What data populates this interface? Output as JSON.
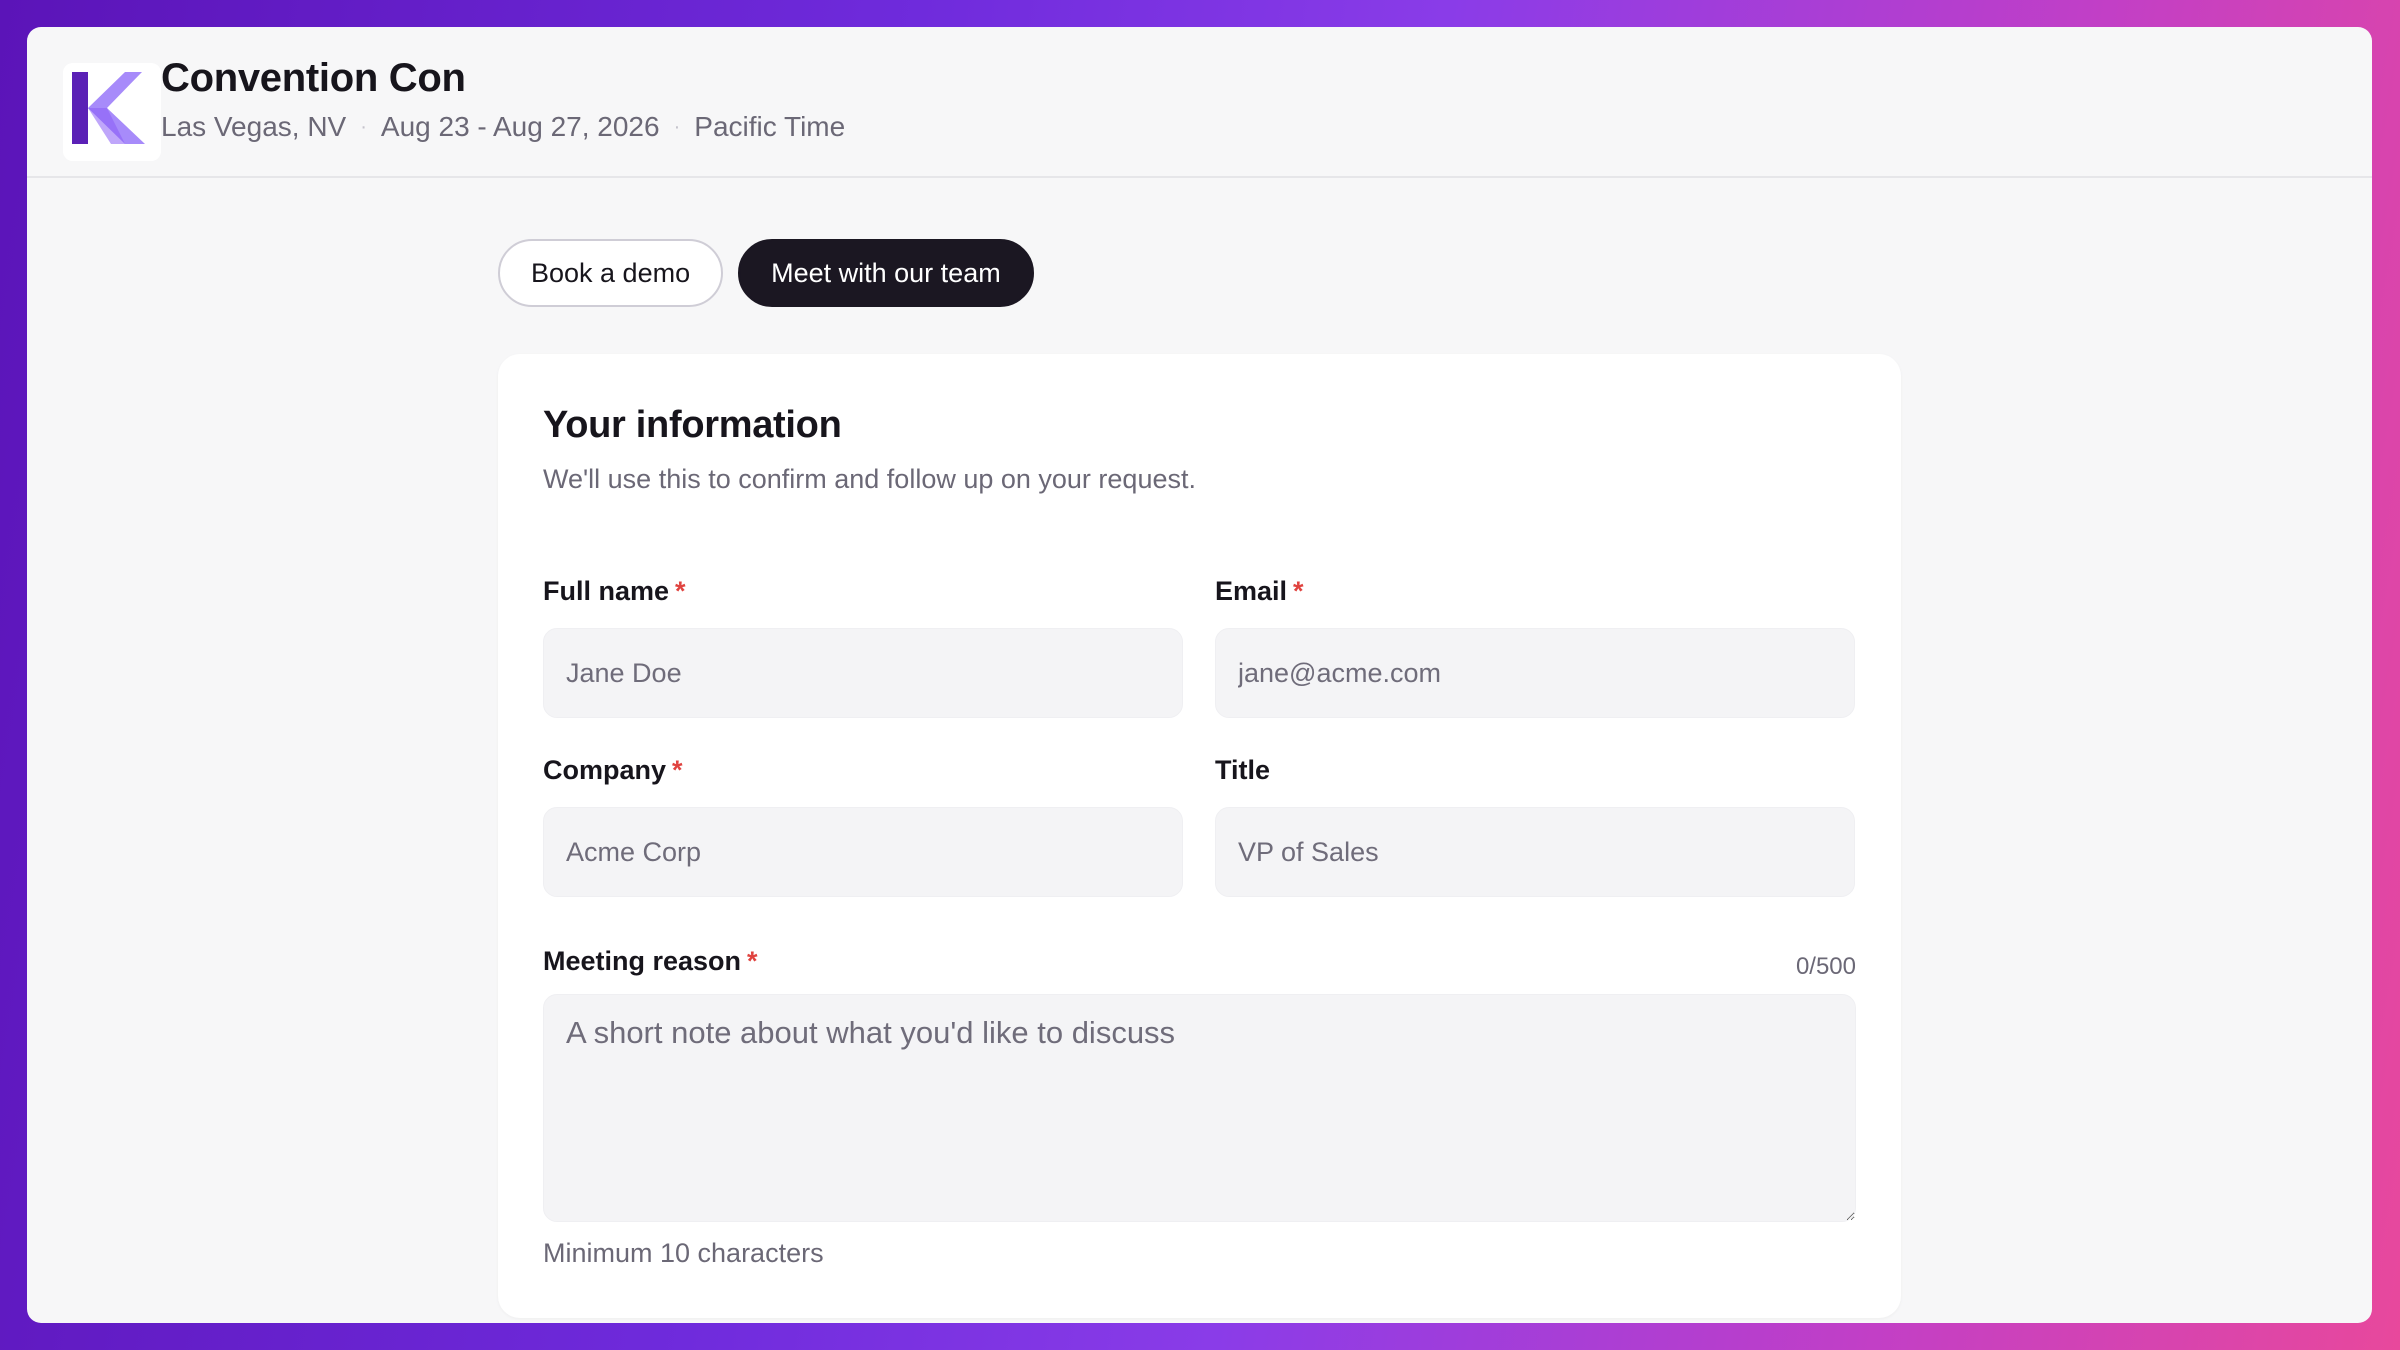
{
  "event": {
    "title": "Convention Con",
    "location": "Las Vegas, NV",
    "dates": "Aug 23 - Aug 27, 2026",
    "timezone": "Pacific Time",
    "logo_icon": "k-logo-icon",
    "accent_dark": "#5b21b6",
    "accent_light": "#a78bfa"
  },
  "tabs": [
    {
      "label": "Book a demo",
      "active": false
    },
    {
      "label": "Meet with our team",
      "active": true
    }
  ],
  "form": {
    "title": "Your information",
    "subtitle": "We'll use this to confirm and follow up on your request.",
    "required_marker": "*",
    "fields": {
      "full_name": {
        "label": "Full name",
        "required": true,
        "placeholder": "Jane Doe",
        "value": ""
      },
      "email": {
        "label": "Email",
        "required": true,
        "placeholder": "jane@acme.com",
        "value": ""
      },
      "company": {
        "label": "Company",
        "required": true,
        "placeholder": "Acme Corp",
        "value": ""
      },
      "title": {
        "label": "Title",
        "required": false,
        "placeholder": "VP of Sales",
        "value": ""
      },
      "meeting_reason": {
        "label": "Meeting reason",
        "required": true,
        "placeholder": "A short note about what you'd like to discuss",
        "value": "",
        "counter": "0/500",
        "hint": "Minimum 10 characters"
      }
    }
  }
}
